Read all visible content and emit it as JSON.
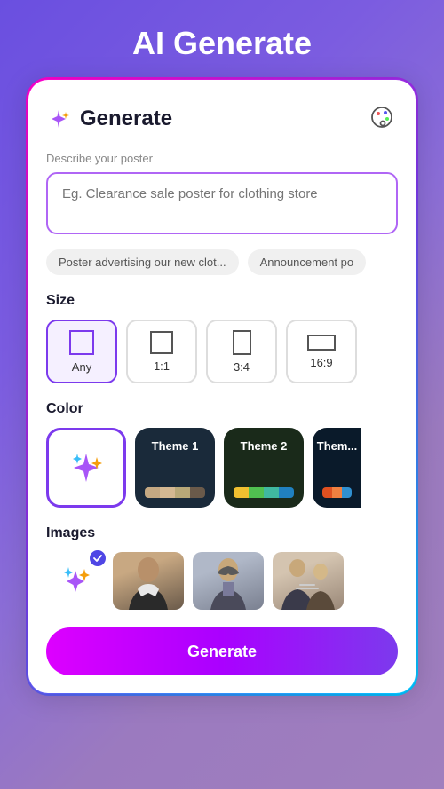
{
  "page": {
    "title": "AI Generate"
  },
  "card": {
    "header": {
      "title": "Generate"
    },
    "input": {
      "label": "Describe your poster",
      "placeholder": "Eg. Clearance sale poster for clothing store"
    },
    "suggestions": [
      {
        "id": "s1",
        "label": "Poster advertising our new clot..."
      },
      {
        "id": "s2",
        "label": "Announcement po"
      }
    ],
    "size": {
      "title": "Size",
      "options": [
        {
          "id": "any",
          "label": "Any",
          "active": true
        },
        {
          "id": "1-1",
          "label": "1:1",
          "active": false
        },
        {
          "id": "3-4",
          "label": "3:4",
          "active": false
        },
        {
          "id": "16-9",
          "label": "16:9",
          "active": false
        }
      ]
    },
    "color": {
      "title": "Color",
      "themes": [
        {
          "id": "sparkle",
          "type": "sparkle",
          "active": true
        },
        {
          "id": "theme1",
          "label": "Theme 1",
          "background": "#1a2a3a",
          "colors": [
            "#c4a882",
            "#d4b892",
            "#b8a878",
            "#6a5a4a"
          ],
          "active": false
        },
        {
          "id": "theme2",
          "label": "Theme 2",
          "background": "#1a2a1a",
          "colors": [
            "#f0c030",
            "#50c050",
            "#40b8a0",
            "#2080c0"
          ],
          "active": false
        },
        {
          "id": "theme3",
          "label": "Them...",
          "background": "#0a1a2a",
          "colors": [
            "#e05020",
            "#f08040",
            "#e0d0b0",
            "#3090d0"
          ],
          "active": false
        }
      ]
    },
    "images": {
      "title": "Images",
      "items": [
        {
          "id": "ai",
          "type": "ai-generate"
        },
        {
          "id": "img1",
          "type": "photo",
          "desc": "Man in suit"
        },
        {
          "id": "img2",
          "type": "photo",
          "desc": "Woman in blazer"
        },
        {
          "id": "img3",
          "type": "photo",
          "desc": "Team meeting"
        }
      ]
    },
    "generateButton": {
      "label": "Generate"
    }
  }
}
